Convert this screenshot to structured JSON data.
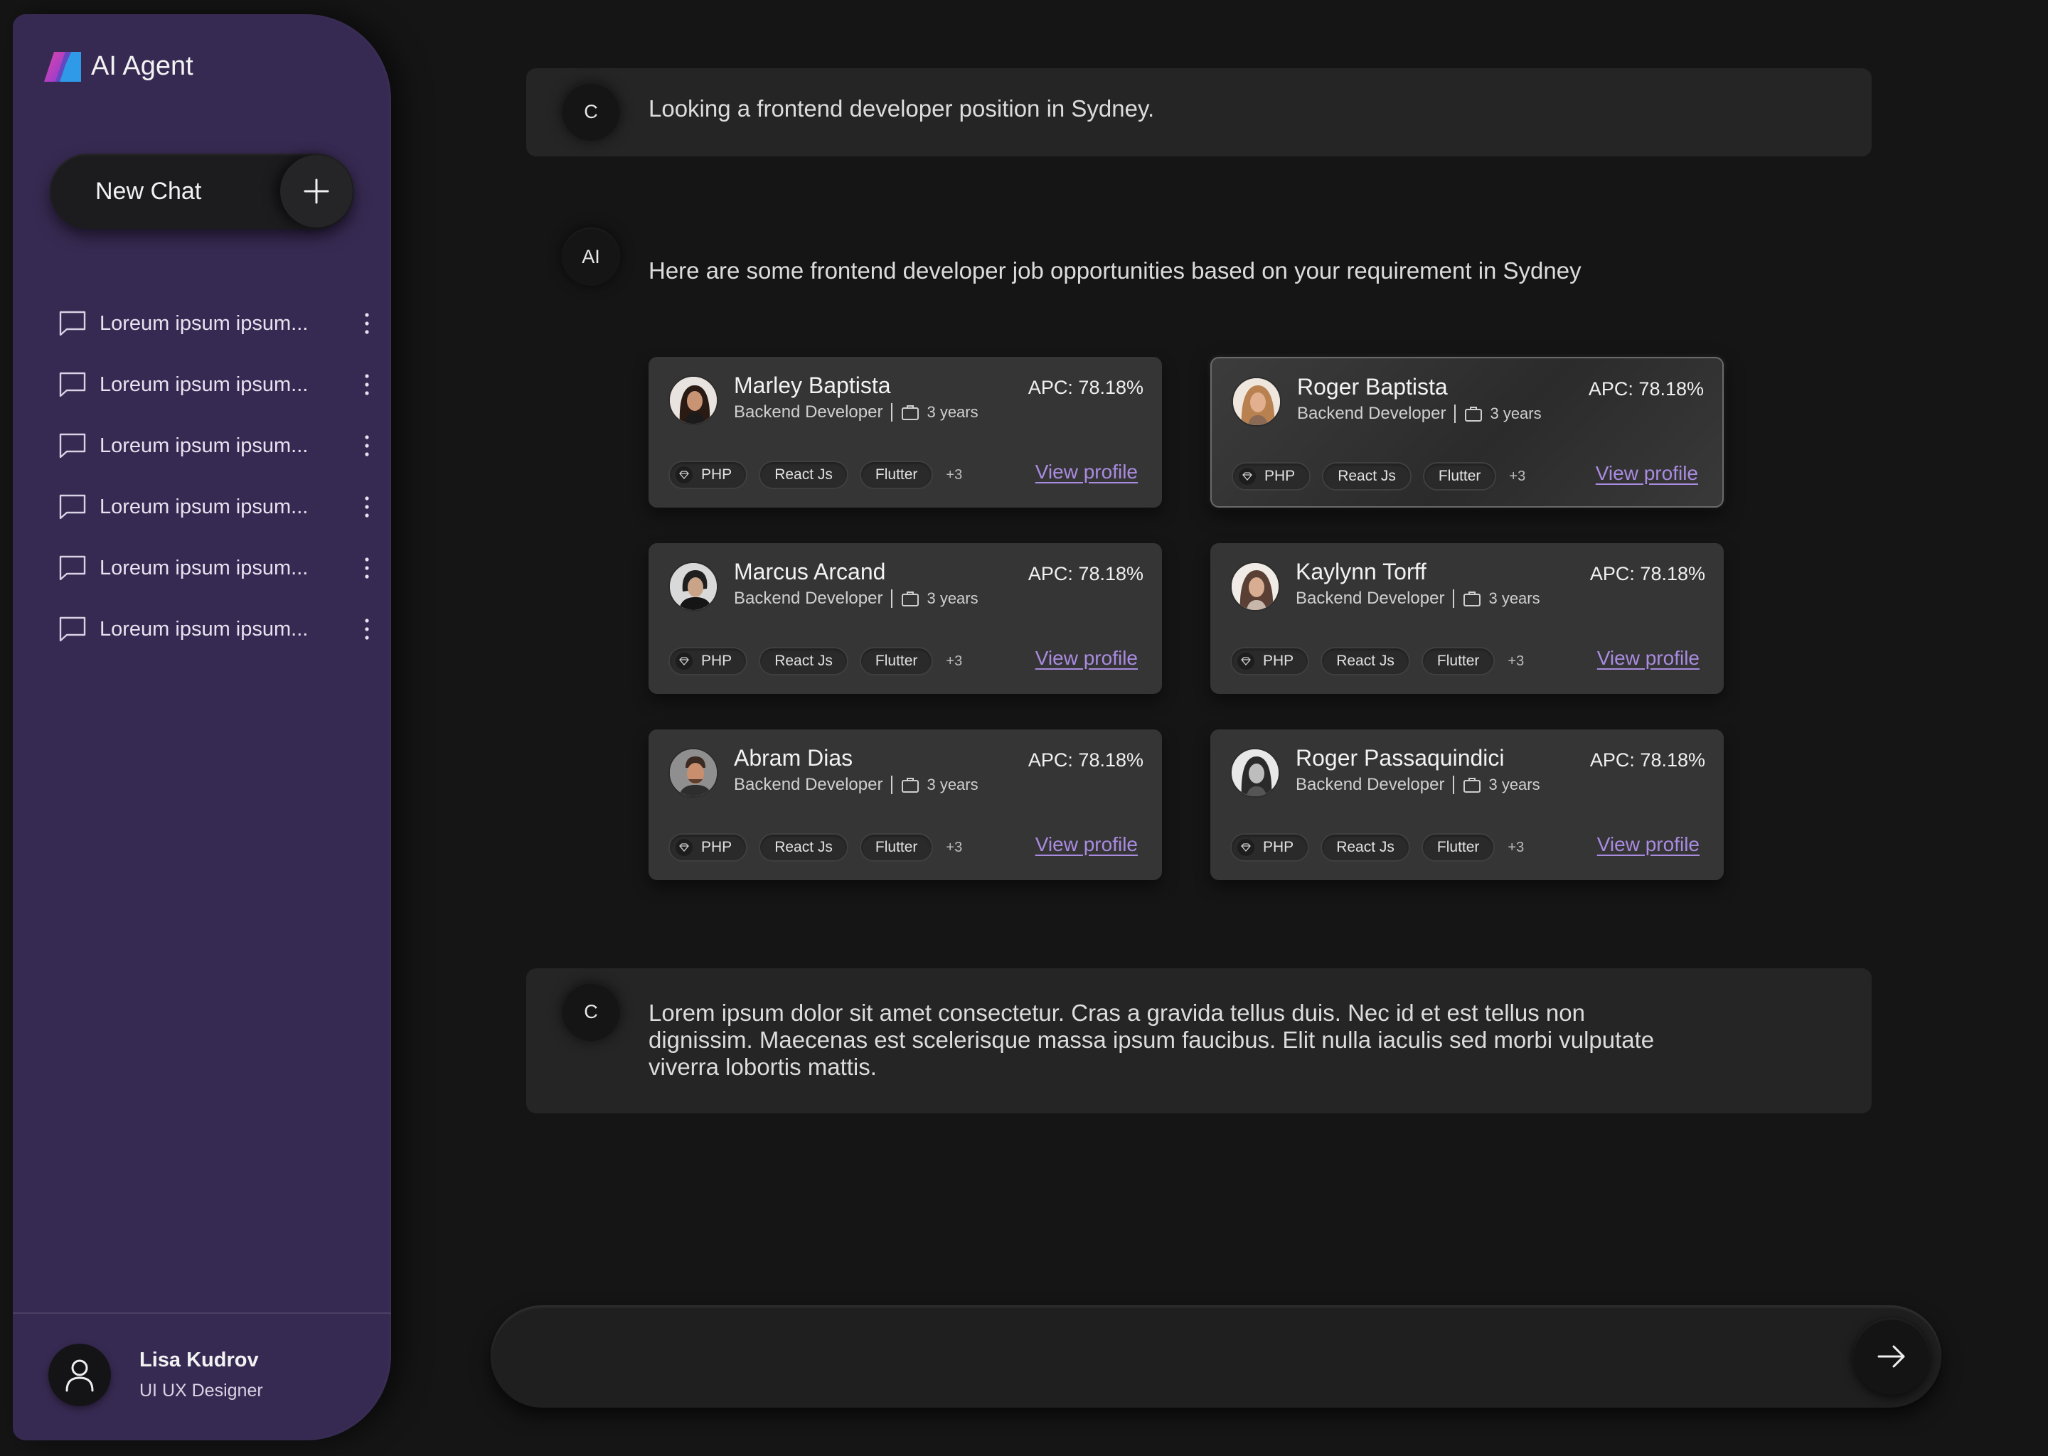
{
  "app": {
    "name": "AI Agent"
  },
  "sidebar": {
    "new_chat_label": "New Chat",
    "history": [
      {
        "label": "Loreum ipsum ipsum..."
      },
      {
        "label": "Loreum ipsum ipsum..."
      },
      {
        "label": "Loreum ipsum ipsum..."
      },
      {
        "label": "Loreum ipsum ipsum..."
      },
      {
        "label": "Loreum ipsum ipsum..."
      },
      {
        "label": "Loreum ipsum ipsum..."
      }
    ],
    "user": {
      "name": "Lisa Kudrov",
      "role": "UI UX Designer"
    }
  },
  "chat": {
    "user_initial": "C",
    "ai_initial": "AI",
    "messages": [
      {
        "from": "C",
        "text": "Looking a frontend developer position in Sydney."
      },
      {
        "from": "AI",
        "text": "Here are some frontend developer job opportunities based on your requirement in Sydney"
      },
      {
        "from": "C",
        "text": "Lorem ipsum dolor sit amet consectetur. Cras a gravida tellus duis. Nec id et est tellus non dignissim. Maecenas est scelerisque massa ipsum faucibus. Elit nulla iaculis sed morbi vulputate viverra lobortis mattis."
      }
    ]
  },
  "candidates": [
    {
      "name": "Marley Baptista",
      "role": "Backend Developer",
      "experience": "3 years",
      "apc": "APC: 78.18%",
      "tags": [
        "PHP",
        "React Js",
        "Flutter"
      ],
      "more": "+3",
      "link": "View profile"
    },
    {
      "name": "Roger Baptista",
      "role": "Backend Developer",
      "experience": "3 years",
      "apc": "APC: 78.18%",
      "tags": [
        "PHP",
        "React Js",
        "Flutter"
      ],
      "more": "+3",
      "link": "View profile"
    },
    {
      "name": "Marcus Arcand",
      "role": "Backend Developer",
      "experience": "3 years",
      "apc": "APC: 78.18%",
      "tags": [
        "PHP",
        "React Js",
        "Flutter"
      ],
      "more": "+3",
      "link": "View profile"
    },
    {
      "name": "Kaylynn Torff",
      "role": "Backend Developer",
      "experience": "3 years",
      "apc": "APC: 78.18%",
      "tags": [
        "PHP",
        "React Js",
        "Flutter"
      ],
      "more": "+3",
      "link": "View profile"
    },
    {
      "name": "Abram Dias",
      "role": "Backend Developer",
      "experience": "3 years",
      "apc": "APC: 78.18%",
      "tags": [
        "PHP",
        "React Js",
        "Flutter"
      ],
      "more": "+3",
      "link": "View profile"
    },
    {
      "name": "Roger Passaquindici",
      "role": "Backend Developer",
      "experience": "3 years",
      "apc": "APC: 78.18%",
      "tags": [
        "PHP",
        "React Js",
        "Flutter"
      ],
      "more": "+3",
      "link": "View profile"
    }
  ],
  "input": {
    "placeholder": ""
  },
  "colors": {
    "sidebar": "#372a52",
    "background": "#151515",
    "card": "#353535",
    "link": "#a98be0",
    "logo_pink": "#c43bb0",
    "logo_blue": "#2f9be8"
  }
}
